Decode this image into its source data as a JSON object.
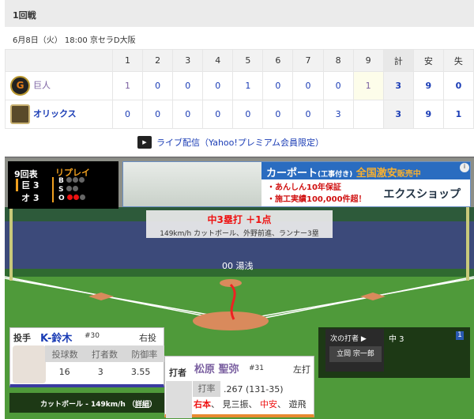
{
  "header": {
    "title": "1回戦",
    "date": "6月8日（火） 18:00 京セラD大阪"
  },
  "scoreboard": {
    "columns": [
      "1",
      "2",
      "3",
      "4",
      "5",
      "6",
      "7",
      "8",
      "9",
      "計",
      "安",
      "失"
    ],
    "teams": [
      {
        "name": "巨人",
        "innings": [
          "1",
          "0",
          "0",
          "0",
          "1",
          "0",
          "0",
          "0",
          "1"
        ],
        "total": "3",
        "hits": "9",
        "errors": "0"
      },
      {
        "name": "オリックス",
        "innings": [
          "0",
          "0",
          "0",
          "0",
          "0",
          "0",
          "0",
          "3",
          ""
        ],
        "total": "3",
        "hits": "9",
        "errors": "1"
      }
    ]
  },
  "live_link": "ライブ配信（Yahoo!プレミアム会員限定）",
  "situation": {
    "inning": "9回表",
    "mode": "リプレイ",
    "teams": [
      {
        "abbr": "巨",
        "score": "3"
      },
      {
        "abbr": "オ",
        "score": "3"
      }
    ],
    "b": "B",
    "s": "S",
    "o": "O",
    "balls": 0,
    "strikes": 0,
    "outs": 2
  },
  "ad": {
    "headline": "カーポート",
    "sub": "(工事付き)",
    "badge": "全国激安",
    "badge2": "販売中",
    "line1": "・あんしん10年保証",
    "line2": "・施工実績100,000件超！",
    "brand": "エクスショップ"
  },
  "play": {
    "result": "中3塁打 ＋1点",
    "detail": "149km/h カットボール、外野前進、ランナー3塁"
  },
  "runner": {
    "label": "00 湯浅"
  },
  "pitcher": {
    "role": "投手",
    "name": "K-鈴木",
    "number": "#30",
    "hand": "右投",
    "stat_labels": [
      "投球数",
      "打者数",
      "防御率"
    ],
    "stat_values": [
      "16",
      "3",
      "3.55"
    ],
    "pitch": "カットボール - 149km/h",
    "detail_open": "（",
    "detail_link": "詳細",
    "detail_close": "）"
  },
  "batter": {
    "role": "打者",
    "name": "松原 聖弥",
    "number": "#31",
    "hand": "左打",
    "avg_label": "打率",
    "avg": ".267 (131-35)",
    "results": [
      {
        "t": "右本",
        "hit": true
      },
      {
        "t": "、 見三振、 ",
        "hit": false
      },
      {
        "t": "中安",
        "hit": true
      },
      {
        "t": "、 遊飛",
        "hit": false
      }
    ]
  },
  "next": {
    "label": "次の打者 ▶",
    "name": "立岡 宗一郎",
    "position": "中 3",
    "count": "1"
  },
  "colors": {
    "link": "#1a3cb5",
    "giants": "#7a5fa0",
    "hit": "#e11"
  }
}
